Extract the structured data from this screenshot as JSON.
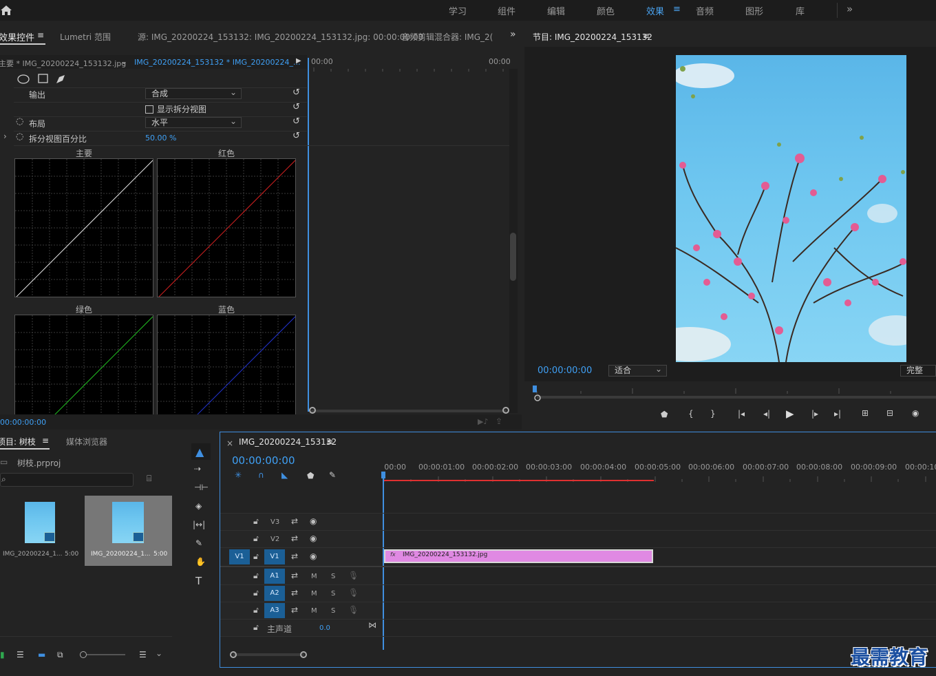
{
  "workspaces": [
    "学习",
    "组件",
    "编辑",
    "颜色",
    "效果",
    "音频",
    "图形",
    "库"
  ],
  "workspace_active": "效果",
  "workspace_more": "»",
  "menu_icon": "≡",
  "effect_panel": {
    "tabs": [
      "效果控件",
      "Lumetri 范围",
      "源: IMG_20200224_153132: IMG_20200224_153132.jpg: 00:00:00:00",
      "音频剪辑混合器: IMG_2("
    ],
    "master_clip": "主要 * IMG_20200224_153132.jpg",
    "sequence_clip": "IMG_20200224_153132 * IMG_20200224_...",
    "time_start": "00:00",
    "time_end": "00:00",
    "output_label": "输出",
    "output_value": "合成",
    "split_view_label": "显示拆分视图",
    "layout_label": "布局",
    "layout_value": "水平",
    "split_percent_label": "拆分视图百分比",
    "split_percent_value": "50.00 %",
    "curves": [
      "主要",
      "红色",
      "绿色",
      "蓝色"
    ],
    "timecode": "00:00:00:00"
  },
  "program_monitor": {
    "title": "节目: IMG_20200224_153132",
    "timecode": "00:00:00:00",
    "fit": "适合",
    "quality": "完整"
  },
  "project_panel": {
    "tabs": [
      "项目: 树枝",
      "媒体浏览器"
    ],
    "project_file": "树枝.prproj",
    "items": [
      {
        "name": "IMG_20200224_1...",
        "duration": "5:00"
      },
      {
        "name": "IMG_20200224_1...",
        "duration": "5:00"
      }
    ]
  },
  "timeline": {
    "close": "×",
    "title": "IMG_20200224_153132",
    "timecode": "00:00:00:00",
    "ruler": [
      "00:00",
      "00:00:01:00",
      "00:00:02:00",
      "00:00:03:00",
      "00:00:04:00",
      "00:00:05:00",
      "00:00:06:00",
      "00:00:07:00",
      "00:00:08:00",
      "00:00:09:00",
      "00:00:10:"
    ],
    "video_tracks": [
      "V3",
      "V2",
      "V1"
    ],
    "source_patch": "V1",
    "audio_tracks": [
      "A1",
      "A2",
      "A3"
    ],
    "mute": "M",
    "solo": "S",
    "master_label": "主声道",
    "master_value": "0.0",
    "clip_name": "IMG_20200224_153132.jpg",
    "fx_badge": "fx"
  },
  "watermark": "最需教育",
  "colors": {
    "accent": "#3fa0f5",
    "clip": "#e089e3",
    "work_area": "#e03030"
  }
}
